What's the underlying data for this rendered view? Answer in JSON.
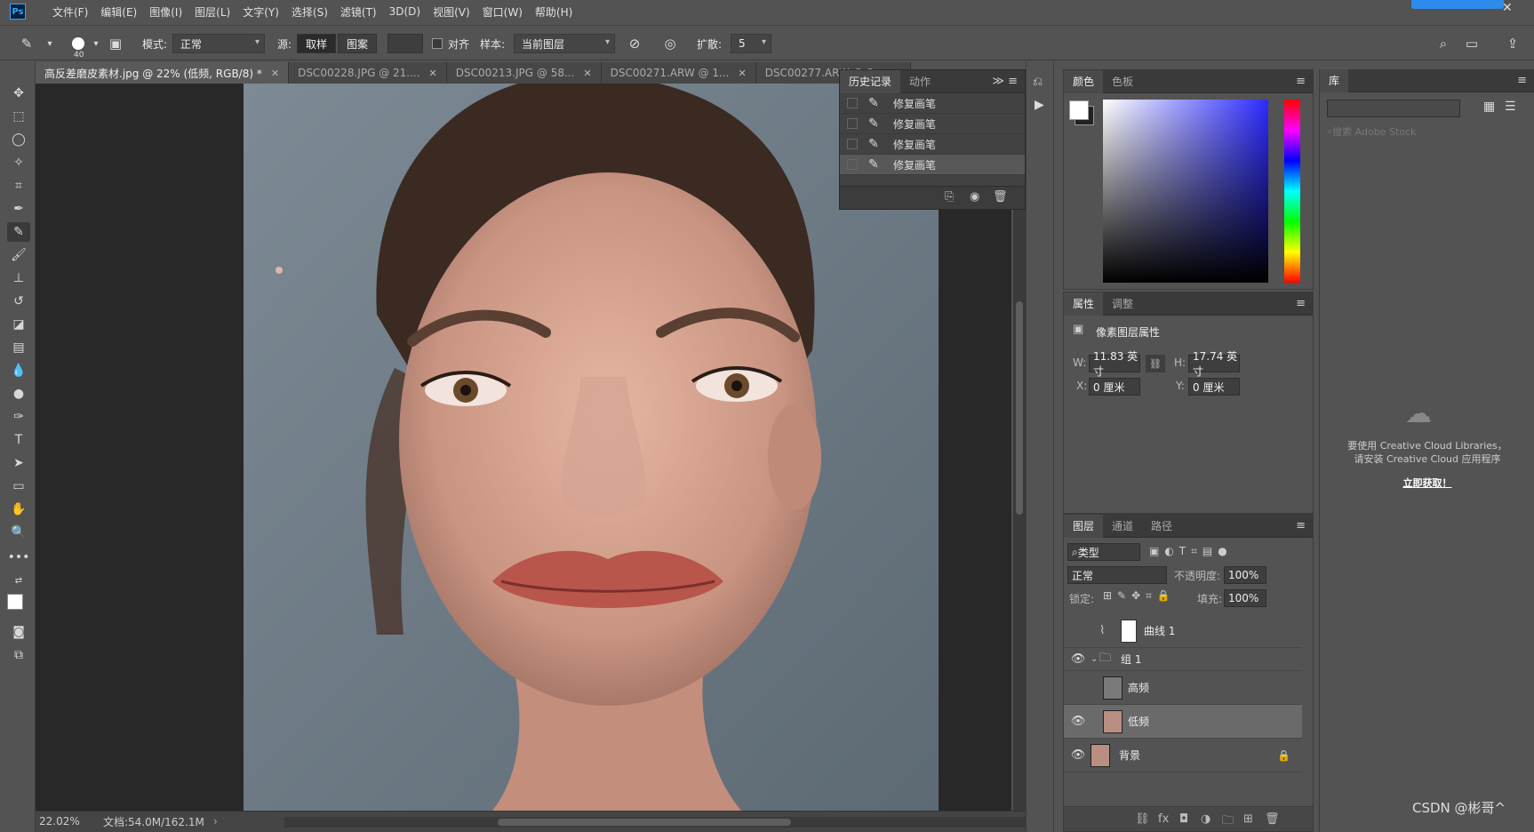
{
  "menu": {
    "logo": "Ps",
    "items": [
      "文件(F)",
      "编辑(E)",
      "图像(I)",
      "图层(L)",
      "文字(Y)",
      "选择(S)",
      "滤镜(T)",
      "3D(D)",
      "视图(V)",
      "窗口(W)",
      "帮助(H)"
    ]
  },
  "options": {
    "brush_size": "40",
    "mode_label": "模式:",
    "mode_value": "正常",
    "source_label": "源:",
    "source_sampled": "取样",
    "source_pattern": "图案",
    "aligned_label": "对齐",
    "sample_label": "样本:",
    "sample_value": "当前图层",
    "diffusion_label": "扩散:",
    "diffusion_value": "5"
  },
  "tabs": [
    {
      "label": "高反差磨皮素材.jpg @ 22% (低频, RGB/8) *",
      "active": true
    },
    {
      "label": "DSC00228.JPG @ 21....",
      "active": false
    },
    {
      "label": "DSC00213.JPG @ 58...",
      "active": false
    },
    {
      "label": "DSC00271.ARW @ 1...",
      "active": false
    },
    {
      "label": "DSC00277.ARW @ 3...",
      "active": false
    }
  ],
  "status": {
    "zoom": "22.02%",
    "doc_info": "文档:54.0M/162.1M"
  },
  "history": {
    "tab_history": "历史记录",
    "tab_actions": "动作",
    "items": [
      "修复画笔",
      "修复画笔",
      "修复画笔",
      "修复画笔"
    ]
  },
  "color_panel": {
    "tab_color": "颜色",
    "tab_swatches": "色板",
    "foreground": "#ffffff",
    "background": "#222222"
  },
  "properties": {
    "tab_properties": "属性",
    "tab_adjustments": "调整",
    "title": "像素图层属性",
    "w_label": "W:",
    "w_value": "11.83 英寸",
    "h_label": "H:",
    "h_value": "17.74 英寸",
    "x_label": "X:",
    "x_value": "0 厘米",
    "y_label": "Y:",
    "y_value": "0 厘米"
  },
  "layers": {
    "tab_layers": "图层",
    "tab_channels": "通道",
    "tab_paths": "路径",
    "filter_kind": "类型",
    "blend_mode": "正常",
    "opacity_label": "不透明度:",
    "opacity_value": "100%",
    "lock_label": "锁定:",
    "fill_label": "填充:",
    "fill_value": "100%",
    "rows": [
      {
        "name": "曲线 1",
        "visible": false,
        "selected": false
      },
      {
        "name": "组 1",
        "visible": true,
        "selected": false
      },
      {
        "name": "高频",
        "visible": false,
        "selected": false
      },
      {
        "name": "低频",
        "visible": true,
        "selected": true
      },
      {
        "name": "背景",
        "visible": true,
        "selected": false
      }
    ]
  },
  "library": {
    "tab": "库",
    "search_placeholder": "搜索 Adobe Stock",
    "message_line1": "要使用 Creative Cloud Libraries，",
    "message_line2": "请安装 Creative Cloud 应用程序",
    "get_now": "立即获取！"
  },
  "watermark": "CSDN @彬哥^"
}
